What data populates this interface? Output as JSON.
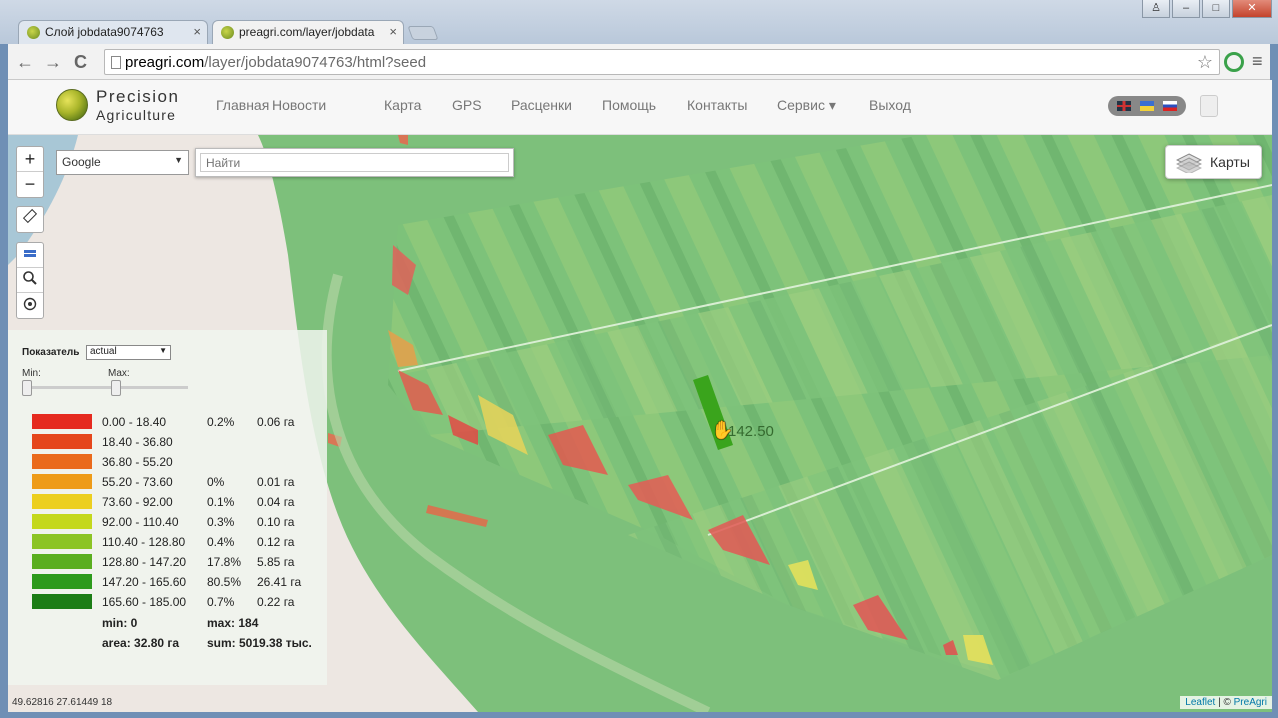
{
  "browser": {
    "tabs": [
      {
        "label": "Слой jobdata9074763",
        "close": "×"
      },
      {
        "label": "preagri.com/layer/jobdata",
        "close": "×"
      }
    ],
    "url_host": "preagri.com",
    "url_path": "/layer/jobdata9074763/html?seed",
    "window_buttons": {
      "user": "♙",
      "minimize": "–",
      "maximize": "□",
      "close": "✕"
    },
    "nav": {
      "back": "←",
      "forward": "→",
      "reload": "C",
      "star": "☆",
      "menu": "≡"
    }
  },
  "site": {
    "logo_line1": "Precision",
    "logo_line2": "Agriculture",
    "nav_items": [
      "Главная",
      "Новости",
      "Карта",
      "GPS",
      "Расценки",
      "Помощь",
      "Контакты",
      "Сервис",
      "Выход"
    ],
    "service_caret": "▾"
  },
  "map": {
    "zoom_in": "+",
    "zoom_out": "−",
    "provider": "Google",
    "provider_arrow": "▼",
    "search_placeholder": "Найти",
    "layers_label": "Карты",
    "cursor_value": "142.50",
    "coords": "49.62816 27.61449 18",
    "attribution_leaflet": "Leaflet",
    "attribution_sep": " | © ",
    "attribution_preagri": "PreAgri"
  },
  "legend": {
    "metric_label": "Показатель",
    "metric_value": "actual",
    "metric_arrow": "▼",
    "min_label": "Min:",
    "max_label": "Max:",
    "rows": [
      {
        "range": "0.00 - 18.40",
        "pct": "0.2%",
        "ha": "0.06 га",
        "color": "#e52a1f"
      },
      {
        "range": "18.40 - 36.80",
        "pct": "",
        "ha": "",
        "color": "#e5461c"
      },
      {
        "range": "36.80 - 55.20",
        "pct": "",
        "ha": "",
        "color": "#ea6a1c"
      },
      {
        "range": "55.20 - 73.60",
        "pct": "0%",
        "ha": "0.01 га",
        "color": "#ee9b18"
      },
      {
        "range": "73.60 - 92.00",
        "pct": "0.1%",
        "ha": "0.04 га",
        "color": "#eccf1f"
      },
      {
        "range": "92.00 - 110.40",
        "pct": "0.3%",
        "ha": "0.10 га",
        "color": "#c4d81c"
      },
      {
        "range": "110.40 - 128.80",
        "pct": "0.4%",
        "ha": "0.12 га",
        "color": "#8cc424"
      },
      {
        "range": "128.80 - 147.20",
        "pct": "17.8%",
        "ha": "5.85 га",
        "color": "#5aae1f"
      },
      {
        "range": "147.20 - 165.60",
        "pct": "80.5%",
        "ha": "26.41 га",
        "color": "#2d9a1c"
      },
      {
        "range": "165.60 - 185.00",
        "pct": "0.7%",
        "ha": "0.22 га",
        "color": "#1c7d16"
      }
    ],
    "min": "min: 0",
    "max": "max: 184",
    "area": "area: 32.80 га",
    "sum": "sum: 5019.38 тыс."
  }
}
